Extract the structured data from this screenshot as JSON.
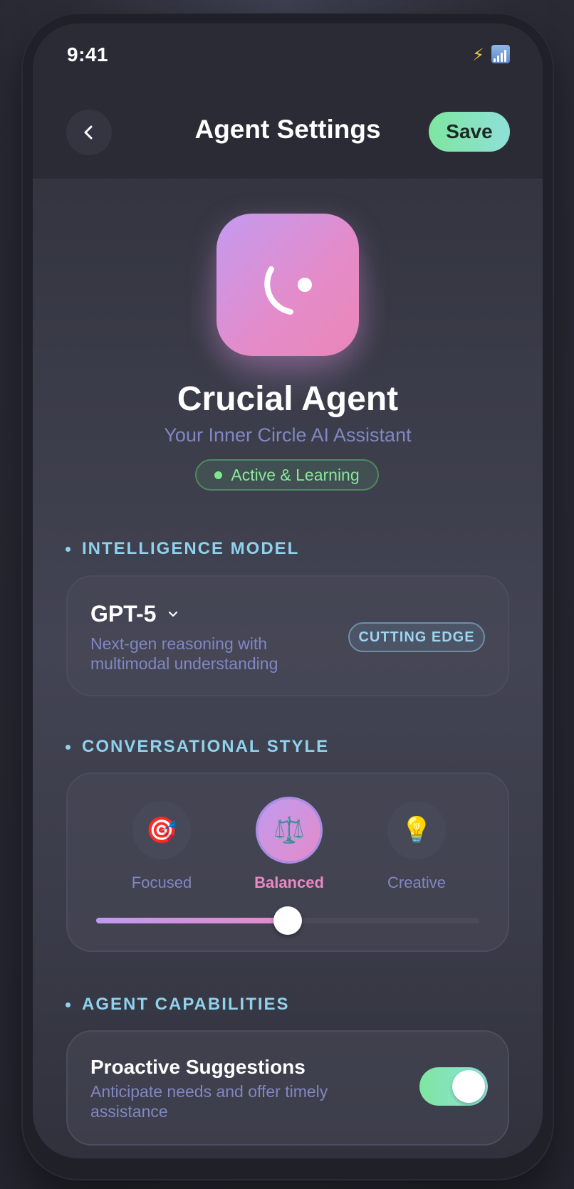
{
  "status_bar": {
    "time": "9:41",
    "icons": [
      "lightning-icon",
      "signal-icon"
    ]
  },
  "header": {
    "title": "Agent Settings",
    "save_label": "Save",
    "back_icon": "chevron-left-icon"
  },
  "agent": {
    "name": "Crucial Agent",
    "subtitle": "Your Inner Circle AI Assistant",
    "status": "Active & Learning"
  },
  "intelligence": {
    "section_title": "INTELLIGENCE MODEL",
    "model": "GPT-5",
    "description": "Next-gen reasoning with multimodal understanding",
    "tag": "CUTTING EDGE"
  },
  "style": {
    "section_title": "CONVERSATIONAL STYLE",
    "options": [
      {
        "label": "Focused",
        "emoji": "🎯",
        "icon": "target-icon"
      },
      {
        "label": "Balanced",
        "emoji": "⚖️",
        "icon": "scales-icon"
      },
      {
        "label": "Creative",
        "emoji": "💡",
        "icon": "lightbulb-icon"
      }
    ],
    "selected": "Balanced",
    "slider_fraction": 0.5
  },
  "capabilities": {
    "section_title": "AGENT CAPABILITIES",
    "items": [
      {
        "title": "Proactive Suggestions",
        "description": "Anticipate needs and offer timely assistance",
        "enabled": true
      }
    ]
  },
  "colors": {
    "accent_green": "#7ee6a0",
    "accent_pink": "#e58bc8",
    "accent_purple": "#c09af0",
    "section_blue": "#8fd2ee",
    "muted_text": "#8087c2"
  }
}
